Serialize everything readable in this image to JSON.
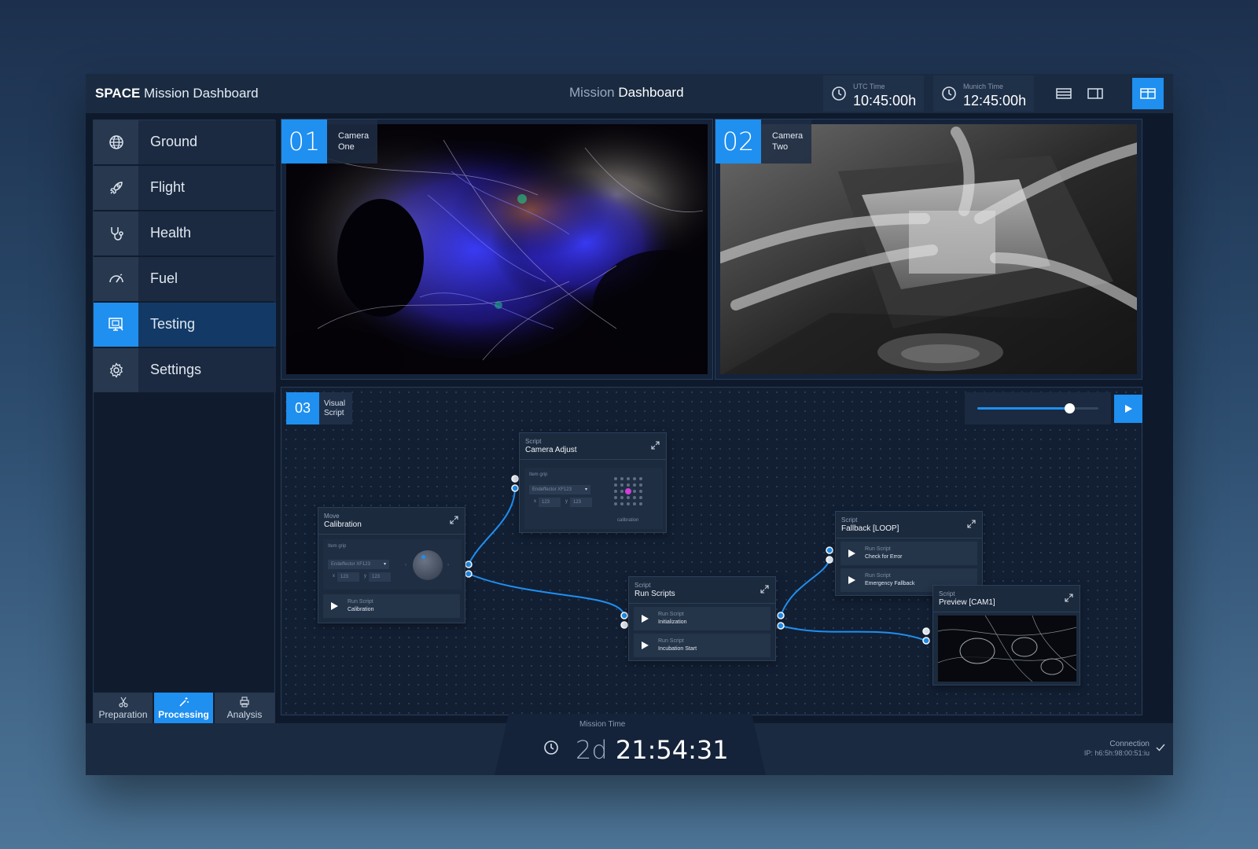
{
  "header": {
    "brand_bold": "SPACE",
    "brand_rest": "Mission Dashboard",
    "center_light": "Mission",
    "center_bold": "Dashboard",
    "clocks": [
      {
        "label": "UTC Time",
        "value": "10:45:00h"
      },
      {
        "label": "Munich Time",
        "value": "12:45:00h"
      }
    ],
    "layouts": [
      "layout-rows-icon",
      "layout-sidebar-icon",
      "layout-columns-icon"
    ],
    "active_layout": 2
  },
  "sidebar": {
    "items": [
      {
        "label": "Ground",
        "icon": "globe-icon"
      },
      {
        "label": "Flight",
        "icon": "rocket-icon"
      },
      {
        "label": "Health",
        "icon": "stethoscope-icon"
      },
      {
        "label": "Fuel",
        "icon": "gauge-icon"
      },
      {
        "label": "Testing",
        "icon": "monitor-icon",
        "active": true
      },
      {
        "label": "Settings",
        "icon": "gear-icon"
      }
    ],
    "tabs": [
      {
        "label": "Preparation",
        "icon": "scissors-icon"
      },
      {
        "label": "Processing",
        "icon": "magic-wand-icon",
        "active": true
      },
      {
        "label": "Analysis",
        "icon": "printer-icon"
      }
    ]
  },
  "cameras": [
    {
      "number": "01",
      "line1": "Camera",
      "line2": "One"
    },
    {
      "number": "02",
      "line1": "Camera",
      "line2": "Two"
    }
  ],
  "visual_script": {
    "number": "03",
    "line1": "Visual",
    "line2": "Script",
    "slider_value": 0.76,
    "nodes": {
      "calibration": {
        "sub": "Move",
        "title": "Calibration",
        "field_label": "Item grip",
        "select": "Endeffector XF123",
        "x_label": "x",
        "x_val": "123",
        "y_label": "y",
        "y_val": "123",
        "row_sub": "Run Script",
        "row_label": "Calibration"
      },
      "camera_adjust": {
        "sub": "Script",
        "title": "Camera Adjust",
        "field_label": "Item grip",
        "select": "Endeffector XF123",
        "x_label": "x",
        "x_val": "123",
        "y_label": "y",
        "y_val": "123",
        "grid_label": "calibration"
      },
      "run_scripts": {
        "sub": "Script",
        "title": "Run Scripts",
        "rows": [
          {
            "sub": "Run Script",
            "label": "Initialization"
          },
          {
            "sub": "Run Script",
            "label": "Incubation Start"
          }
        ]
      },
      "fallback": {
        "sub": "Script",
        "title": "Fallback [LOOP]",
        "rows": [
          {
            "sub": "Run Script",
            "label": "Check for Error"
          },
          {
            "sub": "Run Script",
            "label": "Emergency Fallback"
          }
        ]
      },
      "preview": {
        "sub": "Script",
        "title": "Preview [CAM1]"
      }
    }
  },
  "footer": {
    "mission_label": "Mission Time",
    "days": "2d",
    "time": "21:54:31",
    "conn_label": "Connection",
    "conn_ip": "IP: h6:5h:98:00:51:iu"
  },
  "colors": {
    "accent": "#1f8ff0",
    "panel": "#1a2a41",
    "background": "#0e1a2c"
  }
}
